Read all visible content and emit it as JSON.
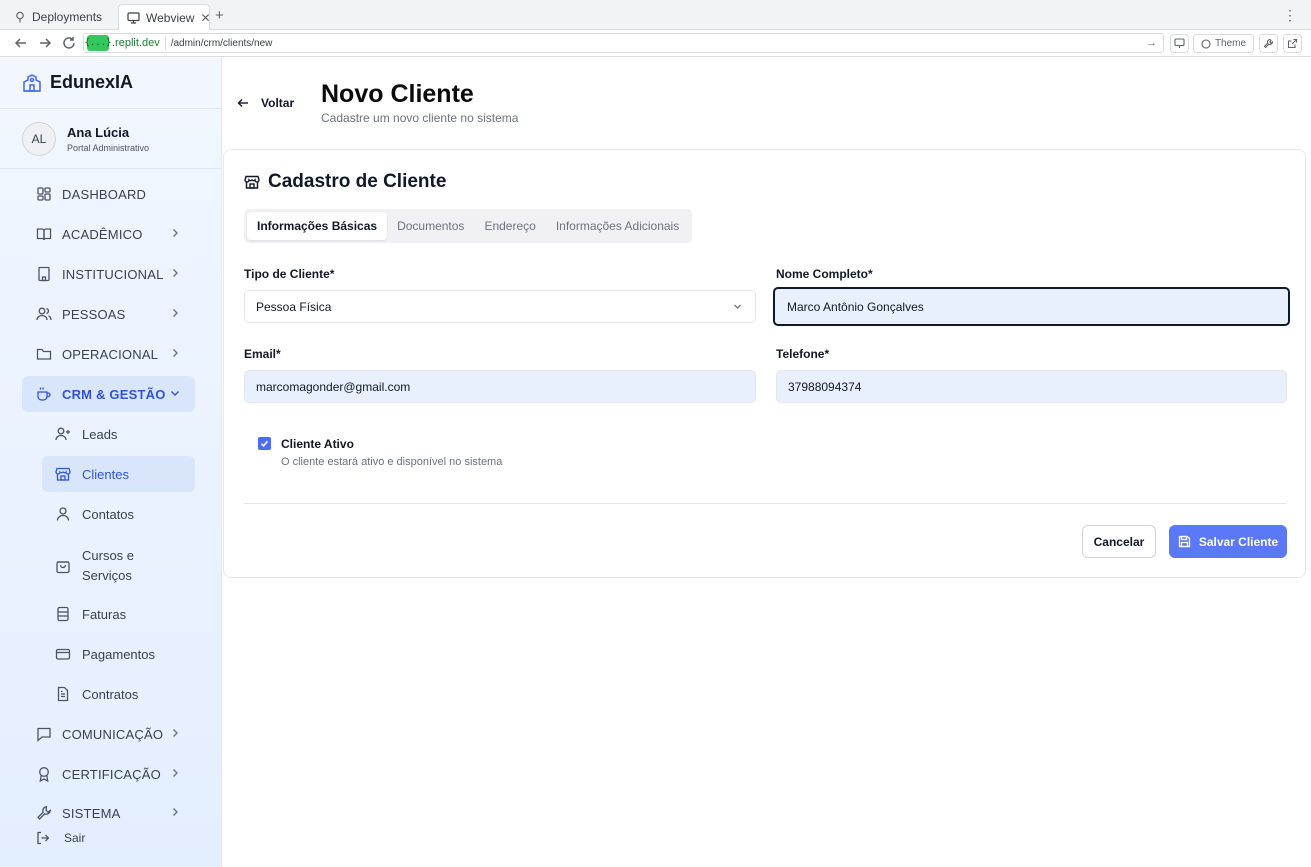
{
  "browser": {
    "tabs": [
      {
        "label": "Deployments",
        "icon": "tree-icon",
        "active": false
      },
      {
        "label": "Webview",
        "icon": "monitor-icon",
        "active": true
      }
    ],
    "url_domain": ".replit.dev",
    "url_path": "/admin/crm/clients/new",
    "theme_label": "Theme"
  },
  "sidebar": {
    "brand": "EdunexIA",
    "user": {
      "initials": "AL",
      "name": "Ana Lúcia",
      "role": "Portal Administrativo"
    },
    "nav": [
      {
        "label": "DASHBOARD",
        "icon": "dashboard-icon",
        "expandable": false
      },
      {
        "label": "ACADÊMICO",
        "icon": "book-icon",
        "expandable": true
      },
      {
        "label": "INSTITUCIONAL",
        "icon": "building-icon",
        "expandable": true
      },
      {
        "label": "PESSOAS",
        "icon": "users-icon",
        "expandable": true
      },
      {
        "label": "OPERACIONAL",
        "icon": "folder-icon",
        "expandable": true
      },
      {
        "label": "CRM & GESTÃO",
        "icon": "coffee-icon",
        "expandable": true,
        "active": true
      }
    ],
    "crm_sub": [
      {
        "label": "Leads",
        "icon": "user-plus-icon"
      },
      {
        "label": "Clientes",
        "icon": "store-icon",
        "active": true
      },
      {
        "label": "Contatos",
        "icon": "user-icon"
      },
      {
        "label": "Cursos e Serviços",
        "icon": "bag-icon"
      },
      {
        "label": "Faturas",
        "icon": "receipt-icon"
      },
      {
        "label": "Pagamentos",
        "icon": "credit-card-icon"
      },
      {
        "label": "Contratos",
        "icon": "file-icon"
      }
    ],
    "nav_bottom": [
      {
        "label": "COMUNICAÇÃO",
        "icon": "message-icon",
        "expandable": true
      },
      {
        "label": "CERTIFICAÇÃO",
        "icon": "award-icon",
        "expandable": true
      },
      {
        "label": "SISTEMA",
        "icon": "wrench-icon",
        "expandable": true
      }
    ],
    "logout": "Sair"
  },
  "header": {
    "back_label": "Voltar",
    "title": "Novo Cliente",
    "subtitle": "Cadastre um novo cliente no sistema"
  },
  "form": {
    "title": "Cadastro de Cliente",
    "tabs": [
      "Informações Básicas",
      "Documentos",
      "Endereço",
      "Informações Adicionais"
    ],
    "active_tab": "Informações Básicas",
    "client_type_label": "Tipo de Cliente*",
    "client_type_value": "Pessoa Física",
    "full_name_label": "Nome Completo*",
    "full_name_value": "Marco Antônio Gonçalves",
    "email_label": "Email*",
    "email_value": "marcomagonder@gmail.com",
    "phone_label": "Telefone*",
    "phone_value": "37988094374",
    "active_label": "Cliente Ativo",
    "active_checked": true,
    "active_help": "O cliente estará ativo e disponível no sistema",
    "cancel_label": "Cancelar",
    "save_label": "Salvar Cliente"
  },
  "colors": {
    "accent": "#4d6cf5",
    "sidebar_active_bg": "#d8e5fb",
    "input_filled_bg": "#e8f0fe"
  }
}
